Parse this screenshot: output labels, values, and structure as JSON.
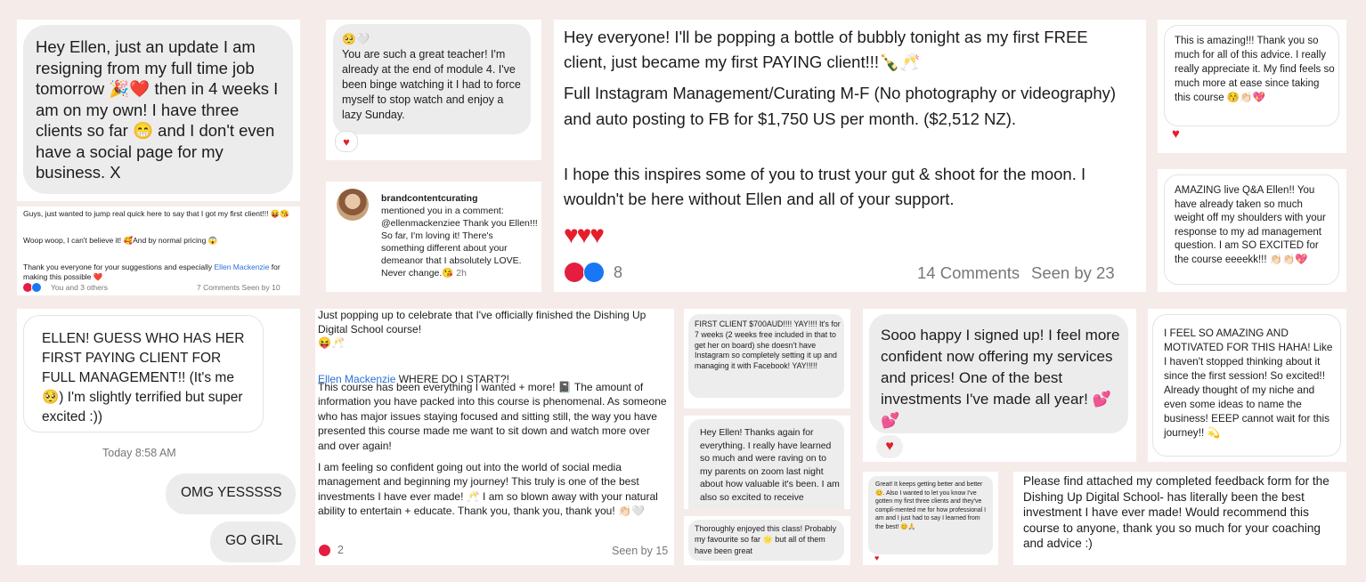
{
  "c1": {
    "text": "Hey Ellen, just an update I am resigning from my full time job tomorrow 🎉❤️ then in 4 weeks I am on my own! I have three clients so far 😁 and I don't even have a social page for my business. X"
  },
  "c2": {
    "text": "🥺🤍\nYou are such a great teacher! I'm already at the end of module 4. I've been binge watching it I had to force myself to stop watch and enjoy a lazy Sunday.",
    "reaction": "♥"
  },
  "c3": {
    "p1": "Hey everyone! I'll be popping a bottle of bubbly tonight as my first FREE client, just became my first PAYING client!!!🍾🥂",
    "p2": "Full Instagram Management/Curating M-F (No photography or videography) and auto posting to FB for $1,750 US per month. ($2,512 NZ).",
    "p3": "I hope this inspires some of you to trust your gut & shoot for the moon. I wouldn't be here without Ellen and all of your support.",
    "hearts": "♥♥♥",
    "react_count": "8",
    "comments": "14 Comments",
    "seen": "Seen by 23"
  },
  "c4": {
    "text": "This is amazing!!! Thank you so much for all of this advice. I really really appreciate it. My find feels so much more at ease since taking this course 😚👏🏻💖",
    "reaction": "♥"
  },
  "c5": {
    "p1": "Guys, just wanted to jump real quick here to say that I got my first client!!! 😝😘",
    "p2": "Woop woop, I can't believe it! 🥰And by normal pricing 😱",
    "p3a": "Thank you everyone for your suggestions and especially ",
    "p3link": "Ellen Mackenzie",
    "p3b": " for making this possible ❤️",
    "who": "You and 3 others",
    "stats": "7 Comments  Seen by 10"
  },
  "c6": {
    "user": "brandcontentcurating",
    "line1": "mentioned you in a comment:",
    "handle": "@ellenmackenziee",
    "body": " Thank you Ellen!!! So far, I'm loving it! There's something different about your demeanor that I absolutely LOVE. Never change.😘",
    "time": " 2h"
  },
  "c7": {
    "text": "AMAZING live Q&A Ellen!! You have already taken so much weight off my shoulders with your response to my ad management question. I am SO EXCITED for the course eeeekk!!! 👏🏻👏🏻💖"
  },
  "c8": {
    "text": "ELLEN! GUESS WHO HAS HER FIRST PAYING CLIENT FOR FULL MANAGEMENT!! (It's me 🥺) I'm slightly terrified but super excited :))",
    "time": "Today 8:58 AM",
    "reply1": "OMG YESSSSS",
    "reply2": "GO GIRL"
  },
  "c9": {
    "p1": "Just popping up to celebrate that I've officially finished the Dishing Up Digital School course!\n😝🥂",
    "name": "Ellen Mackenzie",
    "name_after": " WHERE DO I START?!",
    "p2": "This course has been everything I wanted + more! 📓 The amount of information you have packed into this course is phenomenal. As someone who has major issues staying focused and sitting still, the way you have presented this course made me want to sit down and watch more over and over again!",
    "p3": "I am feeling so confident going out into the world of social media management and beginning my journey! This truly is one of the best investments I have ever made! 🥂 I am so blown away with your natural ability to entertain + educate. Thank you, thank you, thank you! 👏🏻🤍",
    "count": "2",
    "seen": "Seen by 15"
  },
  "c10": {
    "text": "FIRST CLIENT $700AUD!!!! YAY!!!! It's for 7 weeks (2 weeks free included in that to get her on board) she doesn't have Instagram so completely setting it up and managing it with Facebook! YAY!!!!!"
  },
  "c11": {
    "text": "Hey Ellen! Thanks again for everything. I really have learned so much and were raving on to my parents on zoom last night about how valuable it's been. I am also so excited to receive"
  },
  "c12": {
    "text": "Thoroughly enjoyed this class! Probably my favourite so far 🌟 but all of them have been great"
  },
  "c13": {
    "text": "Sooo happy I signed up! I feel more confident now offering my services and prices! One of the best investments I've made all year! 💕💕",
    "reaction": "♥"
  },
  "c14": {
    "text": "I FEEL SO AMAZING AND MOTIVATED FOR THIS HAHA! Like I haven't stopped thinking about it since the first session! So excited!! Already thought of my niche and even some ideas to name the business! EEEP cannot wait for this journey!! 💫"
  },
  "c15": {
    "text": "Great! It keeps getting better and better 😊. Also I wanted to let you know I've gotten my first three clients and they've compli-mented me for how professional I am and I just had to say I learned from the best! 😊🙏",
    "reaction": "♥"
  },
  "c16": {
    "text": "Please find attached my completed feedback form for the Dishing Up Digital School- has literally been the best investment I have ever made! Would recommend this course to anyone, thank you so much for your coaching and advice :)"
  }
}
